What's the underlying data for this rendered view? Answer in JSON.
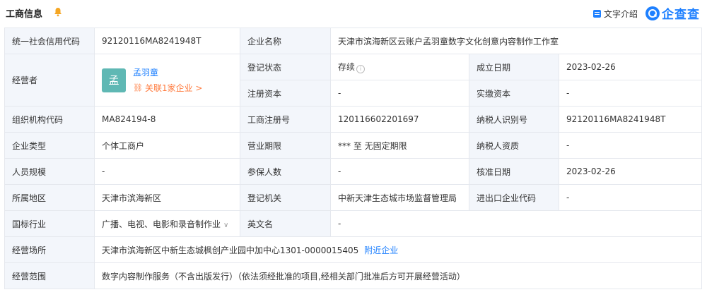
{
  "header": {
    "title": "工商信息",
    "text_intro": "文字介绍",
    "logo_text": "企查查",
    "accent_color": "#1e80ff"
  },
  "table": {
    "credit_code_label": "统一社会信用代码",
    "credit_code": "92120116MA8241948T",
    "company_name_label": "企业名称",
    "company_name": "天津市滨海新区云账户孟羽童数字文化创意内容制作工作室",
    "operator_label": "经营者",
    "operator_avatar": "孟",
    "operator_name": "孟羽童",
    "operator_assoc": "关联1家企业 >",
    "status_label": "登记状态",
    "status": "存续",
    "founded_label": "成立日期",
    "founded": "2023-02-26",
    "reg_capital_label": "注册资本",
    "reg_capital": "-",
    "paid_capital_label": "实缴资本",
    "paid_capital": "-",
    "org_code_label": "组织机构代码",
    "org_code": "MA824194-8",
    "reg_no_label": "工商注册号",
    "reg_no": "120116602201697",
    "taxpayer_id_label": "纳税人识别号",
    "taxpayer_id": "92120116MA8241948T",
    "company_type_label": "企业类型",
    "company_type": "个体工商户",
    "business_term_label": "营业期限",
    "business_term": "*** 至 无固定期限",
    "taxpayer_qual_label": "纳税人资质",
    "taxpayer_qual": "-",
    "staff_size_label": "人员规模",
    "staff_size": "-",
    "insured_label": "参保人数",
    "insured": "-",
    "approval_date_label": "核准日期",
    "approval_date": "2023-02-26",
    "region_label": "所属地区",
    "region": "天津市滨海新区",
    "authority_label": "登记机关",
    "authority": "中新天津生态城市场监督管理局",
    "import_export_label": "进出口企业代码",
    "import_export": "-",
    "industry_label": "国标行业",
    "industry": "广播、电视、电影和录音制作业",
    "english_name_label": "英文名",
    "english_name": "-",
    "address_label": "经营场所",
    "address": "天津市滨海新区中新生态城枫创产业园中加中心1301-0000015405",
    "nearby_link": "附近企业",
    "scope_label": "经营范围",
    "scope": "数字内容制作服务（不含出版发行）（依法须经批准的项目,经相关部门批准后方可开展经营活动）"
  }
}
